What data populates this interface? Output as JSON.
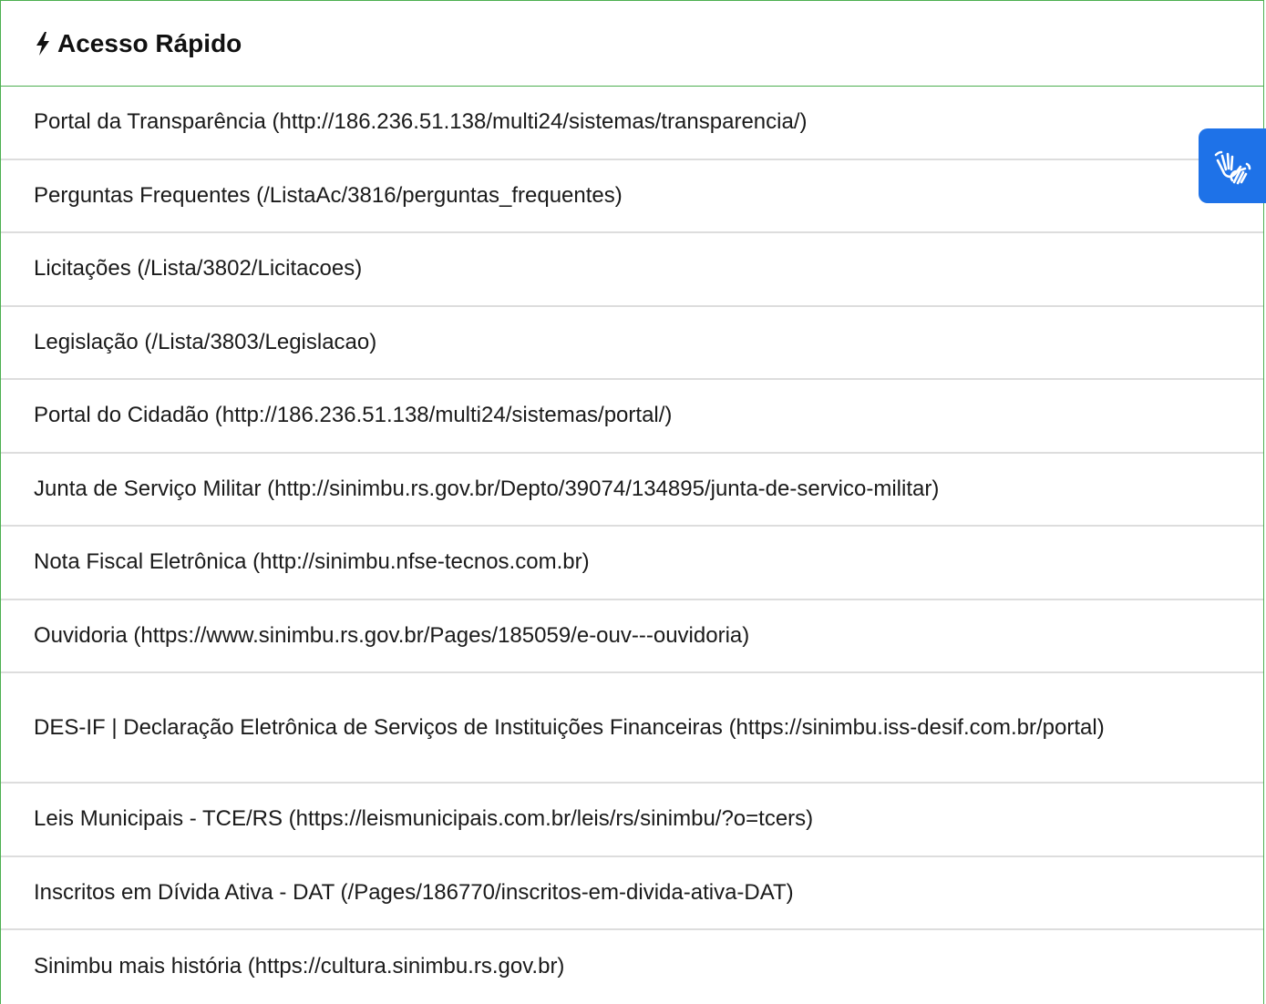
{
  "header": {
    "title": "Acesso Rápido",
    "icon": "bolt-icon"
  },
  "links": [
    {
      "label": "Portal da Transparência (http://186.236.51.138/multi24/sistemas/transparencia/)"
    },
    {
      "label": "Perguntas Frequentes (/ListaAc/3816/perguntas_frequentes)"
    },
    {
      "label": "Licitações (/Lista/3802/Licitacoes)"
    },
    {
      "label": "Legislação (/Lista/3803/Legislacao)"
    },
    {
      "label": "Portal do Cidadão (http://186.236.51.138/multi24/sistemas/portal/)"
    },
    {
      "label": "Junta de Serviço Militar (http://sinimbu.rs.gov.br/Depto/39074/134895/junta-de-servico-militar)"
    },
    {
      "label": "Nota Fiscal Eletrônica (http://sinimbu.nfse-tecnos.com.br)"
    },
    {
      "label": "Ouvidoria (https://www.sinimbu.rs.gov.br/Pages/185059/e-ouv---ouvidoria)"
    },
    {
      "label": "DES-IF | Declaração Eletrônica de Serviços de Instituições Financeiras (https://sinimbu.iss-desif.com.br/portal)"
    },
    {
      "label": "Leis Municipais - TCE/RS (https://leismunicipais.com.br/leis/rs/sinimbu/?o=tcers)"
    },
    {
      "label": "Inscritos em Dívida Ativa - DAT (/Pages/186770/inscritos-em-divida-ativa-DAT)"
    },
    {
      "label": "Sinimbu mais história (https://cultura.sinimbu.rs.gov.br)"
    }
  ],
  "accessibility_button": {
    "icon": "sign-language-hands-icon",
    "color": "#1e72e8"
  },
  "colors": {
    "border_green": "#4caf50",
    "divider": "#dddddd"
  }
}
